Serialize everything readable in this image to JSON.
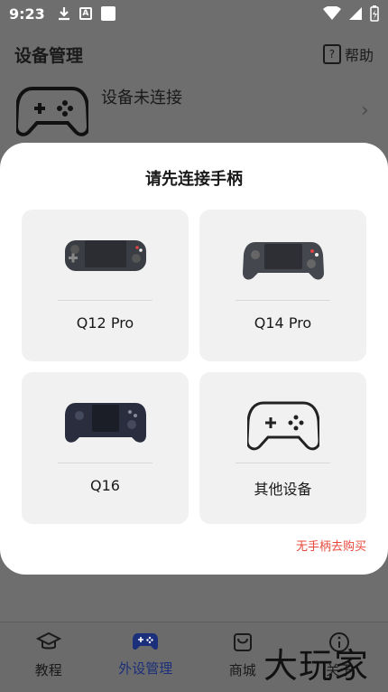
{
  "status_bar": {
    "time": "9:23",
    "notif_letter": "A"
  },
  "header": {
    "title": "设备管理",
    "help_label": "帮助"
  },
  "device": {
    "status": "设备未连接"
  },
  "modal": {
    "title": "请先连接手柄",
    "cards": [
      {
        "label": "Q12 Pro"
      },
      {
        "label": "Q14 Pro"
      },
      {
        "label": "Q16"
      },
      {
        "label": "其他设备"
      }
    ],
    "buy_link": "无手柄去购买"
  },
  "nav": {
    "items": [
      {
        "label": "教程"
      },
      {
        "label": "外设管理"
      },
      {
        "label": "商城"
      },
      {
        "label": "关于"
      }
    ],
    "active_color": "#1b2f7a"
  },
  "watermark": "大玩家"
}
